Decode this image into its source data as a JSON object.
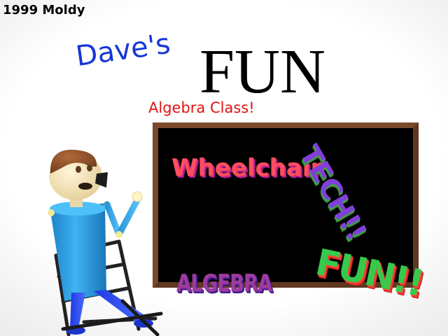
{
  "studio": "1999 Moldy",
  "title": {
    "daves": "Dave's",
    "fun": "FUN",
    "subtitle": "Algebra Class!"
  },
  "board": {
    "word1": "Wheelchair",
    "word2": "TECH!!",
    "word3": "ALGEBRA",
    "word4": "FUN!!"
  },
  "colors": {
    "daves": "#1737d6",
    "subtitle": "#e01414",
    "board_frame": "#7a4a2e",
    "board_surface": "#000000",
    "shirt": "#33a8ee"
  }
}
